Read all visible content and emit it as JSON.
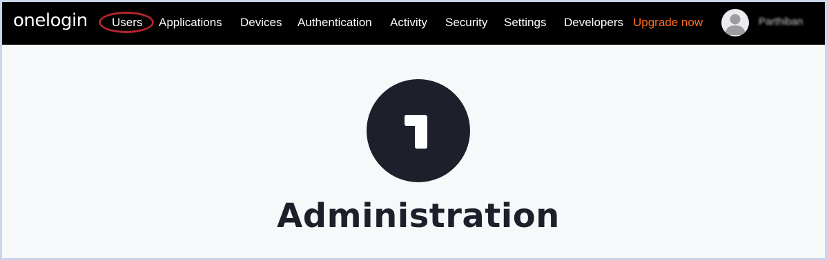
{
  "header": {
    "logo_text": "onelogin",
    "nav": {
      "users": "Users",
      "applications": "Applications",
      "devices": "Devices",
      "authentication": "Authentication",
      "activity": "Activity",
      "security": "Security",
      "settings": "Settings",
      "developers": "Developers",
      "upgrade": "Upgrade now"
    },
    "user": {
      "name": "Parthiban",
      "avatar_icon": "user-avatar-icon"
    }
  },
  "main": {
    "hero_number": "1",
    "title": "Administration"
  },
  "colors": {
    "topbar_bg": "#000000",
    "upgrade_accent": "#ff6f1f",
    "highlight_ring": "#b3242f",
    "hero_dark": "#1d1f2b",
    "page_bg": "#f7f8fa"
  }
}
